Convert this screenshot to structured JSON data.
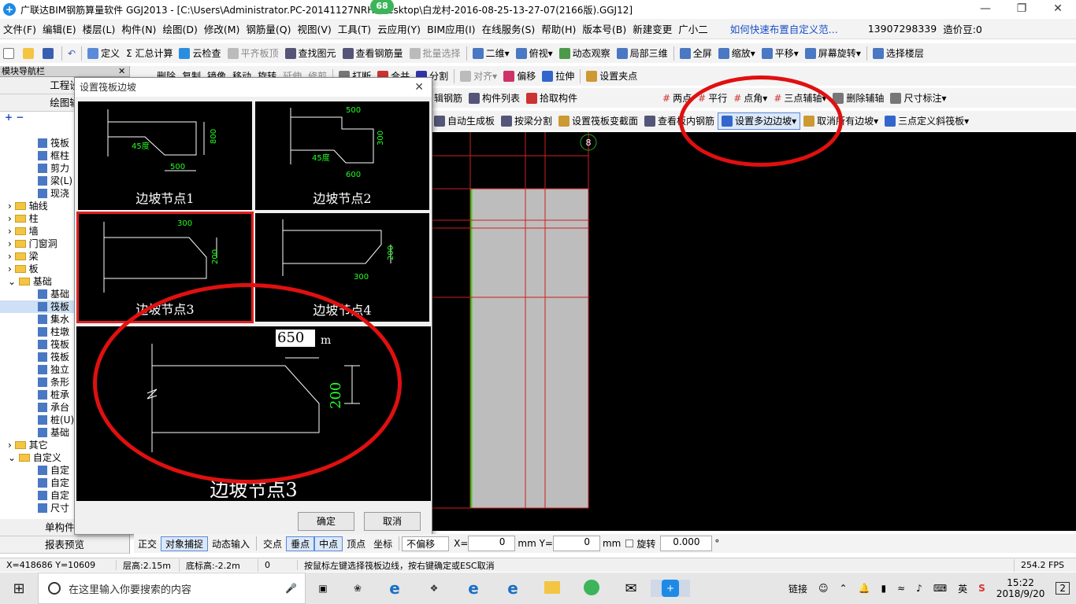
{
  "window": {
    "title": "广联达BIM钢筋算量软件 GGJ2013 - [C:\\Users\\Administrator.PC-20141127NRHI\\Desktop\\白龙村-2016-08-25-13-27-07(2166版).GGJ12]",
    "badge": "68"
  },
  "menu": [
    "文件(F)",
    "编辑(E)",
    "楼层(L)",
    "构件(N)",
    "绘图(D)",
    "修改(M)",
    "钢筋量(Q)",
    "视图(V)",
    "工具(T)",
    "云应用(Y)",
    "BIM应用(I)",
    "在线服务(S)",
    "帮助(H)",
    "版本号(B)",
    "新建变更",
    "广小二",
    "如何快速布置自定义范...",
    "13907298339",
    "造价豆:0"
  ],
  "toolbar1": [
    "定义",
    "Σ 汇总计算",
    "云检查",
    "平齐板顶",
    "查找图元",
    "查看钢筋量",
    "批量选择",
    "二维",
    "俯视",
    "动态观察",
    "局部三维",
    "全屏",
    "缩放",
    "平移",
    "屏幕旋转",
    "选择楼层"
  ],
  "toolbar2": [
    "删除",
    "复制",
    "镜像",
    "移动",
    "旋转",
    "延伸",
    "修剪",
    "打断",
    "合并",
    "分割",
    "对齐",
    "偏移",
    "拉伸",
    "设置夹点"
  ],
  "toolbar3": [
    "辑钢筋",
    "构件列表",
    "拾取构件",
    "两点",
    "平行",
    "点角",
    "三点辅轴",
    "删除辅轴",
    "尺寸标注"
  ],
  "toolbar4": [
    "自动生成板",
    "按梁分割",
    "设置筏板变截面",
    "查看板内钢筋",
    "设置多边边坡",
    "取消所有边坡",
    "三点定义斜筏板"
  ],
  "leftpanel": {
    "header": "模块导航栏",
    "btn1": "工程设",
    "btn2": "绘图输",
    "tree": [
      "筏板",
      "框柱",
      "剪力",
      "梁(L)",
      "现浇",
      "轴线",
      "柱",
      "墙",
      "门窗洞",
      "梁",
      "板",
      "基础",
      "基础",
      "筏板",
      "集水",
      "柱墩",
      "筏板",
      "筏板",
      "独立",
      "条形",
      "桩承",
      "承台",
      "桩(U)",
      "基础",
      "其它",
      "自定义",
      "自定",
      "自定",
      "自定",
      "尺寸"
    ],
    "bottom1": "单构件输",
    "bottom2": "报表预览"
  },
  "dialog": {
    "title": "设置筏板边坡",
    "nodes": [
      "边坡节点1",
      "边坡节点2",
      "边坡节点3",
      "边坡节点4"
    ],
    "preview_caption": "边坡节点3",
    "preview_input": "650",
    "dims": {
      "d45": "45度",
      "d500": "500",
      "d800": "800",
      "d300": "300",
      "d600": "600",
      "d200": "200",
      "unit": "mm",
      "m": "m"
    },
    "ok": "确定",
    "cancel": "取消"
  },
  "canvas": {
    "axis_label": "8"
  },
  "snapbar": {
    "items": [
      "正交",
      "对象捕捉",
      "动态输入",
      "交点",
      "垂点",
      "中点",
      "顶点",
      "坐标",
      "不偏移"
    ],
    "x_label": "X=",
    "x_val": "0",
    "y_label": "mm Y=",
    "y_val": "0",
    "mm": "mm",
    "rotate": "旋转",
    "rotate_val": "0.000",
    "deg": "°"
  },
  "status": {
    "coords": "X=418686 Y=10609",
    "floor_h": "层高:2.15m",
    "bottom_h": "底标高:-2.2m",
    "zero": "0",
    "hint": "按鼠标左键选择筏板边线，按右键确定或ESC取消",
    "fps": "254.2 FPS"
  },
  "taskbar": {
    "search": "在这里输入你要搜索的内容",
    "link": "链接",
    "lang": "英",
    "time": "15:22",
    "date": "2018/9/20",
    "notif": "2"
  }
}
